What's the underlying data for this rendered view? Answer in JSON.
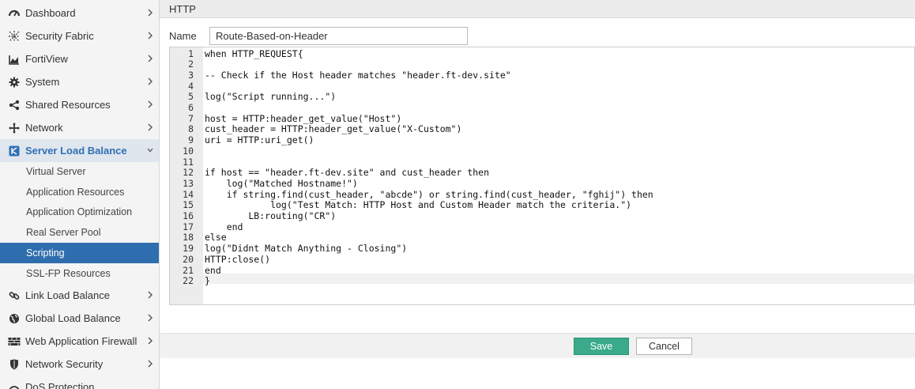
{
  "sidebar": {
    "items": [
      {
        "label": "Dashboard",
        "icon": "dashboard-icon"
      },
      {
        "label": "Security Fabric",
        "icon": "security-fabric-icon"
      },
      {
        "label": "FortiView",
        "icon": "fortiview-icon"
      },
      {
        "label": "System",
        "icon": "gear-icon"
      },
      {
        "label": "Shared Resources",
        "icon": "share-icon"
      },
      {
        "label": "Network",
        "icon": "network-icon"
      },
      {
        "label": "Server Load Balance",
        "icon": "server-load-balance-icon"
      },
      {
        "label": "Link Load Balance",
        "icon": "link-icon"
      },
      {
        "label": "Global Load Balance",
        "icon": "globe-icon"
      },
      {
        "label": "Web Application Firewall",
        "icon": "firewall-icon"
      },
      {
        "label": "Network Security",
        "icon": "shield-icon"
      },
      {
        "label": "DoS Protection",
        "icon": "dos-icon"
      }
    ],
    "subitems": [
      {
        "label": "Virtual Server"
      },
      {
        "label": "Application Resources"
      },
      {
        "label": "Application Optimization"
      },
      {
        "label": "Real Server Pool"
      },
      {
        "label": "Scripting"
      },
      {
        "label": "SSL-FP Resources"
      }
    ],
    "accent_color": "#2f6eae"
  },
  "header": {
    "title": "HTTP"
  },
  "form": {
    "name_label": "Name",
    "name_value": "Route-Based-on-Header"
  },
  "editor": {
    "lines": [
      "when HTTP_REQUEST{",
      "",
      "-- Check if the Host header matches \"header.ft-dev.site\"",
      "",
      "log(\"Script running...\")",
      "",
      "host = HTTP:header_get_value(\"Host\")",
      "cust_header = HTTP:header_get_value(\"X-Custom\")",
      "uri = HTTP:uri_get()",
      "",
      "",
      "if host == \"header.ft-dev.site\" and cust_header then",
      "    log(\"Matched Hostname!\")",
      "    if string.find(cust_header, \"abcde\") or string.find(cust_header, \"fghij\") then",
      "            log(\"Test Match: HTTP Host and Custom Header match the criteria.\")",
      "        LB:routing(\"CR\")",
      "    end",
      "else",
      "log(\"Didnt Match Anything - Closing\")",
      "HTTP:close()",
      "end",
      "}"
    ],
    "line_numbers": [
      "1",
      "2",
      "3",
      "4",
      "5",
      "6",
      "7",
      "8",
      "9",
      "10",
      "11",
      "12",
      "13",
      "14",
      "15",
      "16",
      "17",
      "18",
      "19",
      "20",
      "21",
      "22"
    ]
  },
  "actions": {
    "save_label": "Save",
    "cancel_label": "Cancel",
    "save_color": "#3aaa8a"
  }
}
